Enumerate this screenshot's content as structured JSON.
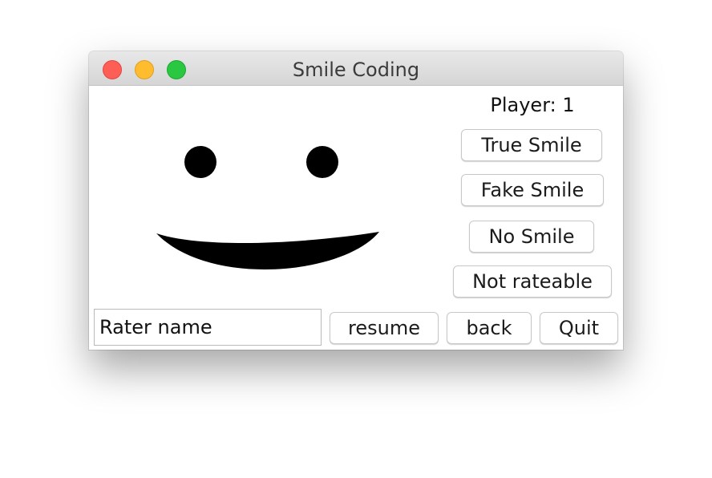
{
  "window": {
    "title": "Smile Coding",
    "controls": [
      "close",
      "minimize",
      "zoom"
    ]
  },
  "face": {
    "icon": "smiley-face-icon",
    "color": "#000000"
  },
  "player": {
    "label": "Player: 1"
  },
  "rating_buttons": {
    "true_smile": "True Smile",
    "fake_smile": "Fake Smile",
    "no_smile": "No Smile",
    "not_rateable": "Not rateable"
  },
  "rater": {
    "value": "Rater name"
  },
  "bottom_buttons": {
    "resume": "resume",
    "back": "back",
    "quit": "Quit"
  },
  "colors": {
    "close": "#fd5f57",
    "minimize": "#febc2e",
    "zoom": "#29c840"
  }
}
